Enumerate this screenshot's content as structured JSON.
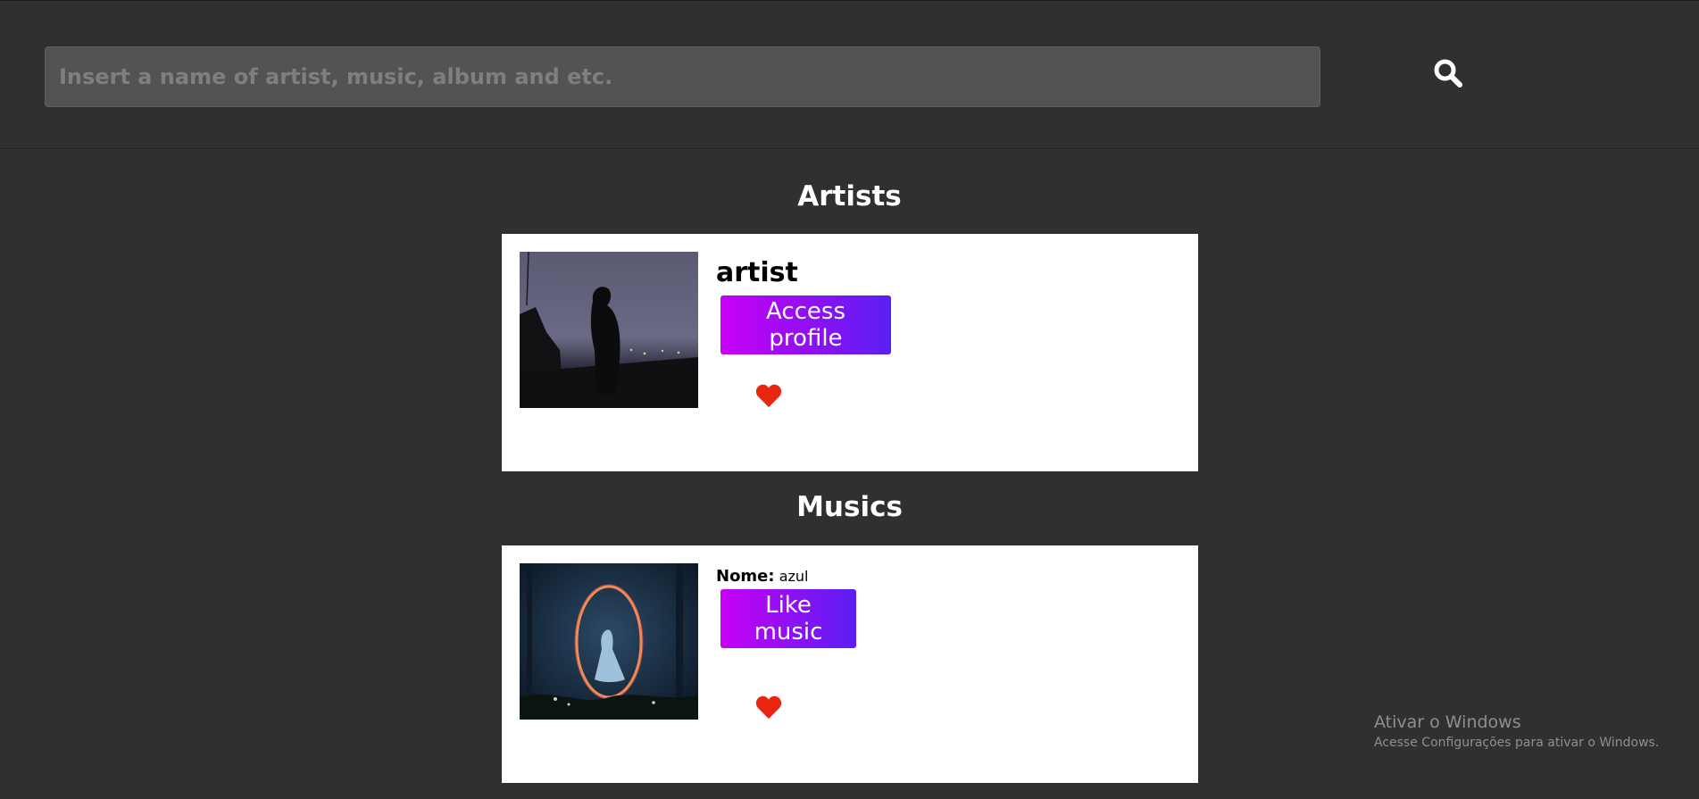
{
  "search": {
    "placeholder": "Insert a name of artist, music, album and etc.",
    "value": ""
  },
  "icons": {
    "search": "search-icon",
    "favorite": "heart-icon"
  },
  "colors": {
    "background": "#303030",
    "search_field": "#535353",
    "button_gradient_start": "#c800f5",
    "button_gradient_end": "#5a1ff2",
    "heart": "#e8250f"
  },
  "artists": {
    "title": "Artists",
    "card": {
      "name": "artist",
      "button_label": "Access profile"
    }
  },
  "musics": {
    "title": "Musics",
    "card": {
      "name_label": "Nome:",
      "name_value": "azul",
      "button_label": "Like music"
    }
  },
  "watermark": {
    "line1": "Ativar o Windows",
    "line2": "Acesse Configurações para ativar o Windows."
  }
}
